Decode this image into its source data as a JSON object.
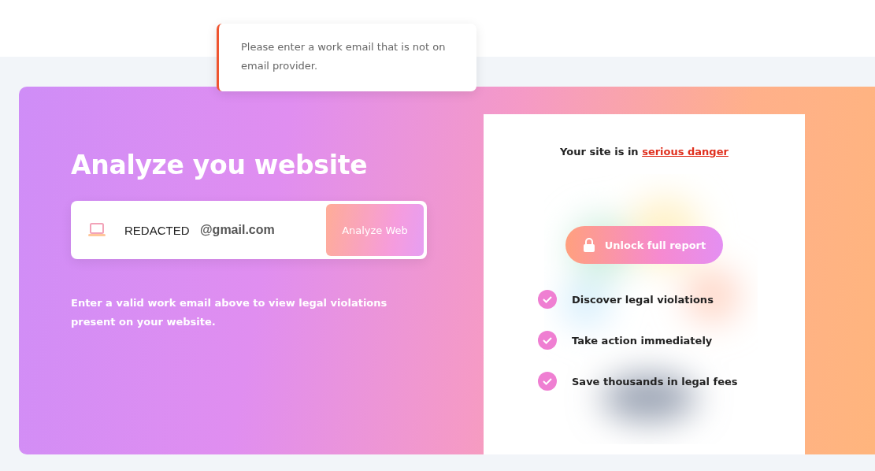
{
  "toast": {
    "message": "Please enter a work email that is not on email provider."
  },
  "hero": {
    "title": "Analyze you website",
    "email_field": {
      "value": "REDACTED",
      "domain": "@gmail.com"
    },
    "submit_button": "Analyze Web",
    "hint": "Enter a valid work email above to view legal violations present on your website."
  },
  "report_card": {
    "heading": "Your site is in **serious danger**",
    "unlock_button": "Unlock full report",
    "benefits": [
      {
        "label": "Discover legal violations",
        "checked": true
      },
      {
        "label": "Take action immediately",
        "checked": true
      },
      {
        "label": "Save thousands in legal fees",
        "checked": true
      }
    ]
  }
}
